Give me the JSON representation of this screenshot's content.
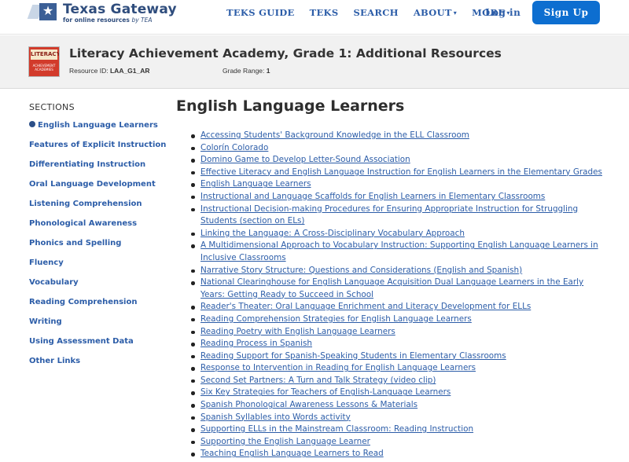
{
  "brand": {
    "logo_icon": "star-icon",
    "name": "Texas Gateway",
    "tagline_main": "for online resources",
    "tagline_by": "by TEA"
  },
  "nav": {
    "items": [
      {
        "label": "TEKS GUIDE",
        "dropdown": false
      },
      {
        "label": "TEKS",
        "dropdown": false
      },
      {
        "label": "SEARCH",
        "dropdown": false
      },
      {
        "label": "ABOUT",
        "dropdown": true
      },
      {
        "label": "MORE",
        "dropdown": true
      }
    ],
    "login_label": "Log in",
    "signup_label": "Sign Up",
    "caret_glyph": "▾"
  },
  "resource": {
    "thumb_title": "LITERACY",
    "thumb_sub": "ACHIEVEMENT ACADEMIES",
    "title": "Literacy Achievement Academy, Grade 1: Additional Resources",
    "id_label": "Resource ID:",
    "id_value": "LAA_G1_AR",
    "grade_label": "Grade Range:",
    "grade_value": "1"
  },
  "sidebar": {
    "title": "SECTIONS",
    "active_index": 0,
    "items": [
      "English Language Learners",
      "Features of Explicit Instruction",
      "Differentiating Instruction",
      "Oral Language Development",
      "Listening Comprehension",
      "Phonological Awareness",
      "Phonics and Spelling",
      "Fluency",
      "Vocabulary",
      "Reading Comprehension",
      "Writing",
      "Using Assessment Data",
      "Other Links"
    ]
  },
  "main": {
    "heading": "English Language Learners",
    "links": [
      "Accessing Students' Background Knowledge in the ELL Classroom",
      "Colorín Colorado",
      "Domino Game to Develop Letter-Sound Association",
      "Effective Literacy and English Language Instruction for English Learners in the Elementary Grades",
      "English Language Learners",
      "Instructional and Language Scaffolds for English Learners in Elementary Classrooms",
      "Instructional Decision-making Procedures for Ensuring Appropriate Instruction for Struggling Students (section on ELs)",
      "Linking the Language: A Cross-Disciplinary Vocabulary Approach",
      "A Multidimensional Approach to Vocabulary Instruction: Supporting English Language Learners in Inclusive Classrooms",
      "Narrative Story Structure: Questions and Considerations (English and Spanish)",
      "National Clearinghouse for English Language Acquisition Dual Language Learners in the Early Years: Getting Ready to Succeed in School",
      "Reader's Theater: Oral Language Enrichment and Literacy Development for ELLs",
      "Reading Comprehension Strategies for English Language Learners",
      "Reading Poetry with English Language Learners",
      "Reading Process in Spanish",
      "Reading Support for Spanish-Speaking Students in Elementary Classrooms",
      "Response to Intervention in Reading for English Language Learners",
      "Second Set Partners: A Turn and Talk Strategy (video clip)",
      "Six Key Strategies for Teachers of English-Language Learners",
      "Spanish Phonological Awareness Lessons & Materials",
      "Spanish Syllables into Words activity",
      "Supporting ELLs in the Mainstream Classroom: Reading Instruction",
      "Supporting the English Language Learner",
      "Teaching English Language Learners to Read"
    ]
  },
  "colors": {
    "link": "#2c5da8",
    "brand": "#2f4d7d",
    "signup_bg": "#0d6ed0",
    "header_bg": "#f1f1f1"
  }
}
